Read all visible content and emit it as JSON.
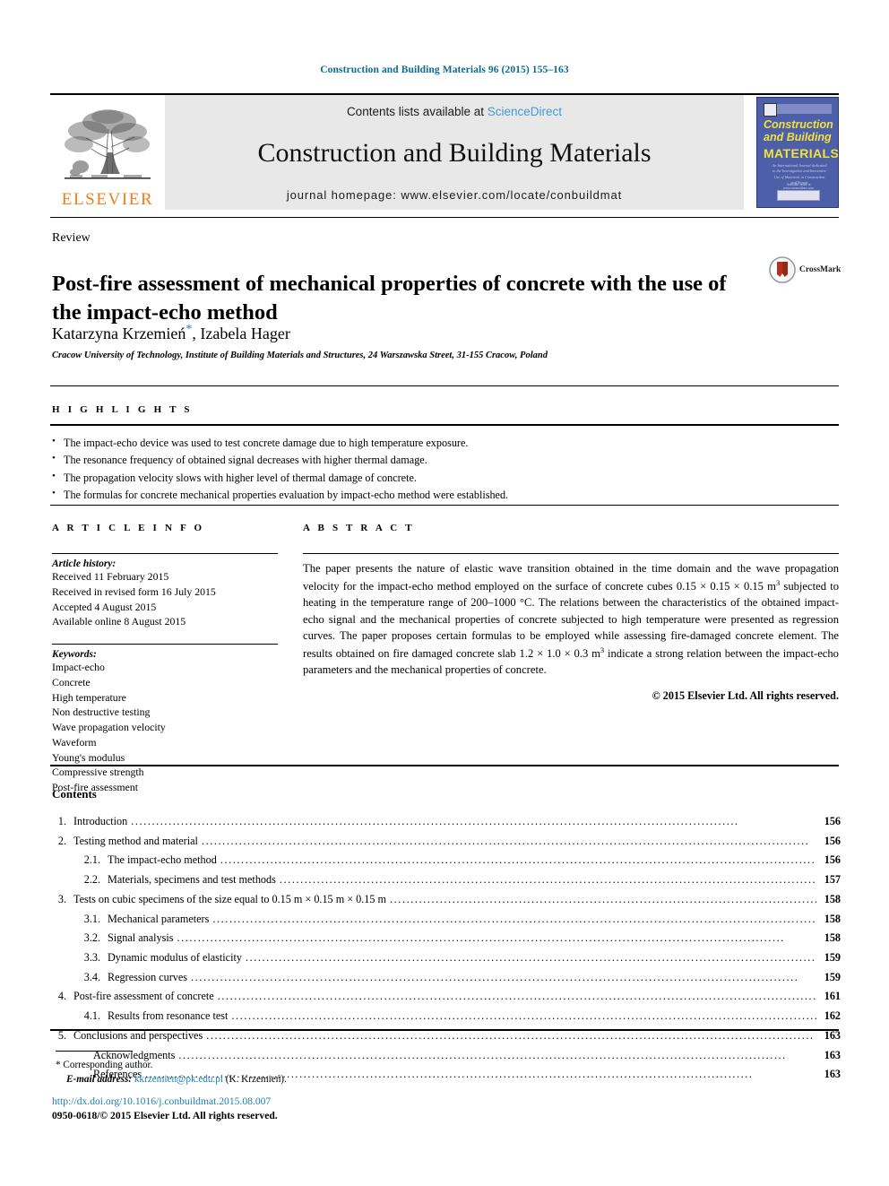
{
  "running_head": "Construction and Building Materials 96 (2015) 155–163",
  "masthead": {
    "publisher_name": "ELSEVIER",
    "contents_prefix": "Contents lists available at ",
    "sciencedirect": "ScienceDirect",
    "journal_title": "Construction and Building Materials",
    "homepage": "journal homepage: www.elsevier.com/locate/conbuildmat",
    "cover": {
      "line1": "Construction",
      "line2": "and Building",
      "line3": "MATERIALS",
      "blurb": "An International Journal dedicated to the Investigation and Innovative Use of Materials in Construction and Repair",
      "footer_small": "Available online at www.sciencedirect.com",
      "footer_box": "ScienceDirect"
    },
    "colors": {
      "running_head": "#0b6a93",
      "sciencedirect_link": "#3e9bd4",
      "elsevier_orange": "#f07d18",
      "band_gray": "#e8e8e8",
      "cover_blue": "#4d5fa8",
      "cover_yellow": "#f2e23a"
    }
  },
  "article": {
    "doctype": "Review",
    "title": "Post-fire assessment of mechanical properties of concrete with the use of the impact-echo method",
    "crossmark_label": "CrossMark",
    "authors": "Katarzyna Krzemień",
    "authors_rest": ", Izabela Hager",
    "corresponding_marker": "*",
    "affiliation": "Cracow University of Technology, Institute of Building Materials and Structures, 24 Warszawska Street, 31-155 Cracow, Poland"
  },
  "highlights": {
    "label": "H I G H L I G H T S",
    "items": [
      "The impact-echo device was used to test concrete damage due to high temperature exposure.",
      "The resonance frequency of obtained signal decreases with higher thermal damage.",
      "The propagation velocity slows with higher level of thermal damage of concrete.",
      "The formulas for concrete mechanical properties evaluation by impact-echo method were established."
    ]
  },
  "article_info": {
    "label": "A R T I C L E   I N F O",
    "history_head": "Article history:",
    "history": [
      "Received 11 February 2015",
      "Received in revised form 16 July 2015",
      "Accepted 4 August 2015",
      "Available online 8 August 2015"
    ],
    "keywords_head": "Keywords:",
    "keywords": [
      "Impact-echo",
      "Concrete",
      "High temperature",
      "Non destructive testing",
      "Wave propagation velocity",
      "Waveform",
      "Young's modulus",
      "Compressive strength",
      "Post-fire assessment"
    ]
  },
  "abstract": {
    "label": "A B S T R A C T",
    "p1": "The paper presents the nature of elastic wave transition obtained in the time domain and the wave propagation velocity for the impact-echo method employed on the surface of concrete cubes 0.15 × 0.15 × 0.15 m",
    "sup1": "3",
    "p2": " subjected to heating in the temperature range of 200–1000 °C. The relations between the characteristics of the obtained impact-echo signal and the mechanical properties of concrete subjected to high temperature were presented as regression curves. The paper proposes certain formulas to be employed while assessing fire-damaged concrete element. The results obtained on fire damaged concrete slab 1.2 × 1.0 × 0.3 m",
    "sup2": "3",
    "p3": " indicate a strong relation between the impact-echo parameters and the mechanical properties of concrete.",
    "copyright": "© 2015 Elsevier Ltd. All rights reserved."
  },
  "contents": {
    "heading": "Contents",
    "entries": [
      {
        "num": "1.",
        "title": "Introduction",
        "page": "156",
        "level": 1
      },
      {
        "num": "2.",
        "title": "Testing method and material",
        "page": "156",
        "level": 1
      },
      {
        "num": "2.1.",
        "title": "The impact-echo method",
        "page": "156",
        "level": 2
      },
      {
        "num": "2.2.",
        "title": "Materials, specimens and test methods",
        "page": "157",
        "level": 2
      },
      {
        "num": "3.",
        "title": "Tests on cubic specimens of the size equal to 0.15 m × 0.15 m × 0.15 m",
        "page": "158",
        "level": 1
      },
      {
        "num": "3.1.",
        "title": "Mechanical parameters",
        "page": "158",
        "level": 2
      },
      {
        "num": "3.2.",
        "title": "Signal analysis",
        "page": "158",
        "level": 2
      },
      {
        "num": "3.3.",
        "title": "Dynamic modulus of elasticity",
        "page": "159",
        "level": 2
      },
      {
        "num": "3.4.",
        "title": "Regression curves",
        "page": "159",
        "level": 2
      },
      {
        "num": "4.",
        "title": "Post-fire assessment of concrete",
        "page": "161",
        "level": 1
      },
      {
        "num": "4.1.",
        "title": "Results from resonance test",
        "page": "162",
        "level": 2
      },
      {
        "num": "5.",
        "title": "Conclusions and perspectives",
        "page": "163",
        "level": 1
      },
      {
        "num": "",
        "title": "Acknowledgments",
        "page": "163",
        "level": 3
      },
      {
        "num": "",
        "title": "References",
        "page": "163",
        "level": 3
      }
    ]
  },
  "footer": {
    "corresponding_marker": "*",
    "corresponding_text": "Corresponding author.",
    "email_label": "E-mail address:",
    "email": "kkrzemien@pk.edu.pl",
    "email_owner": "(K. Krzemień).",
    "doi": "http://dx.doi.org/10.1016/j.conbuildmat.2015.08.007",
    "issn_line": "0950-0618/© 2015 Elsevier Ltd. All rights reserved."
  }
}
